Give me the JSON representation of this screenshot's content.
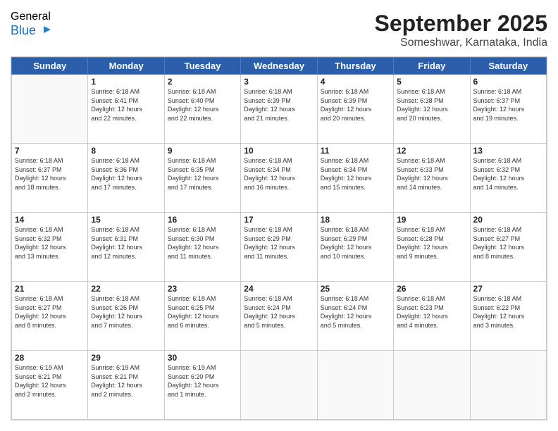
{
  "header": {
    "logo_general": "General",
    "logo_blue": "Blue",
    "title": "September 2025",
    "subtitle": "Someshwar, Karnataka, India"
  },
  "weekdays": [
    "Sunday",
    "Monday",
    "Tuesday",
    "Wednesday",
    "Thursday",
    "Friday",
    "Saturday"
  ],
  "weeks": [
    [
      {
        "day": "",
        "info": ""
      },
      {
        "day": "1",
        "info": "Sunrise: 6:18 AM\nSunset: 6:41 PM\nDaylight: 12 hours\nand 22 minutes."
      },
      {
        "day": "2",
        "info": "Sunrise: 6:18 AM\nSunset: 6:40 PM\nDaylight: 12 hours\nand 22 minutes."
      },
      {
        "day": "3",
        "info": "Sunrise: 6:18 AM\nSunset: 6:39 PM\nDaylight: 12 hours\nand 21 minutes."
      },
      {
        "day": "4",
        "info": "Sunrise: 6:18 AM\nSunset: 6:39 PM\nDaylight: 12 hours\nand 20 minutes."
      },
      {
        "day": "5",
        "info": "Sunrise: 6:18 AM\nSunset: 6:38 PM\nDaylight: 12 hours\nand 20 minutes."
      },
      {
        "day": "6",
        "info": "Sunrise: 6:18 AM\nSunset: 6:37 PM\nDaylight: 12 hours\nand 19 minutes."
      }
    ],
    [
      {
        "day": "7",
        "info": "Sunrise: 6:18 AM\nSunset: 6:37 PM\nDaylight: 12 hours\nand 18 minutes."
      },
      {
        "day": "8",
        "info": "Sunrise: 6:18 AM\nSunset: 6:36 PM\nDaylight: 12 hours\nand 17 minutes."
      },
      {
        "day": "9",
        "info": "Sunrise: 6:18 AM\nSunset: 6:35 PM\nDaylight: 12 hours\nand 17 minutes."
      },
      {
        "day": "10",
        "info": "Sunrise: 6:18 AM\nSunset: 6:34 PM\nDaylight: 12 hours\nand 16 minutes."
      },
      {
        "day": "11",
        "info": "Sunrise: 6:18 AM\nSunset: 6:34 PM\nDaylight: 12 hours\nand 15 minutes."
      },
      {
        "day": "12",
        "info": "Sunrise: 6:18 AM\nSunset: 6:33 PM\nDaylight: 12 hours\nand 14 minutes."
      },
      {
        "day": "13",
        "info": "Sunrise: 6:18 AM\nSunset: 6:32 PM\nDaylight: 12 hours\nand 14 minutes."
      }
    ],
    [
      {
        "day": "14",
        "info": "Sunrise: 6:18 AM\nSunset: 6:32 PM\nDaylight: 12 hours\nand 13 minutes."
      },
      {
        "day": "15",
        "info": "Sunrise: 6:18 AM\nSunset: 6:31 PM\nDaylight: 12 hours\nand 12 minutes."
      },
      {
        "day": "16",
        "info": "Sunrise: 6:18 AM\nSunset: 6:30 PM\nDaylight: 12 hours\nand 11 minutes."
      },
      {
        "day": "17",
        "info": "Sunrise: 6:18 AM\nSunset: 6:29 PM\nDaylight: 12 hours\nand 11 minutes."
      },
      {
        "day": "18",
        "info": "Sunrise: 6:18 AM\nSunset: 6:29 PM\nDaylight: 12 hours\nand 10 minutes."
      },
      {
        "day": "19",
        "info": "Sunrise: 6:18 AM\nSunset: 6:28 PM\nDaylight: 12 hours\nand 9 minutes."
      },
      {
        "day": "20",
        "info": "Sunrise: 6:18 AM\nSunset: 6:27 PM\nDaylight: 12 hours\nand 8 minutes."
      }
    ],
    [
      {
        "day": "21",
        "info": "Sunrise: 6:18 AM\nSunset: 6:27 PM\nDaylight: 12 hours\nand 8 minutes."
      },
      {
        "day": "22",
        "info": "Sunrise: 6:18 AM\nSunset: 6:26 PM\nDaylight: 12 hours\nand 7 minutes."
      },
      {
        "day": "23",
        "info": "Sunrise: 6:18 AM\nSunset: 6:25 PM\nDaylight: 12 hours\nand 6 minutes."
      },
      {
        "day": "24",
        "info": "Sunrise: 6:18 AM\nSunset: 6:24 PM\nDaylight: 12 hours\nand 5 minutes."
      },
      {
        "day": "25",
        "info": "Sunrise: 6:18 AM\nSunset: 6:24 PM\nDaylight: 12 hours\nand 5 minutes."
      },
      {
        "day": "26",
        "info": "Sunrise: 6:18 AM\nSunset: 6:23 PM\nDaylight: 12 hours\nand 4 minutes."
      },
      {
        "day": "27",
        "info": "Sunrise: 6:18 AM\nSunset: 6:22 PM\nDaylight: 12 hours\nand 3 minutes."
      }
    ],
    [
      {
        "day": "28",
        "info": "Sunrise: 6:19 AM\nSunset: 6:21 PM\nDaylight: 12 hours\nand 2 minutes."
      },
      {
        "day": "29",
        "info": "Sunrise: 6:19 AM\nSunset: 6:21 PM\nDaylight: 12 hours\nand 2 minutes."
      },
      {
        "day": "30",
        "info": "Sunrise: 6:19 AM\nSunset: 6:20 PM\nDaylight: 12 hours\nand 1 minute."
      },
      {
        "day": "",
        "info": ""
      },
      {
        "day": "",
        "info": ""
      },
      {
        "day": "",
        "info": ""
      },
      {
        "day": "",
        "info": ""
      }
    ]
  ]
}
